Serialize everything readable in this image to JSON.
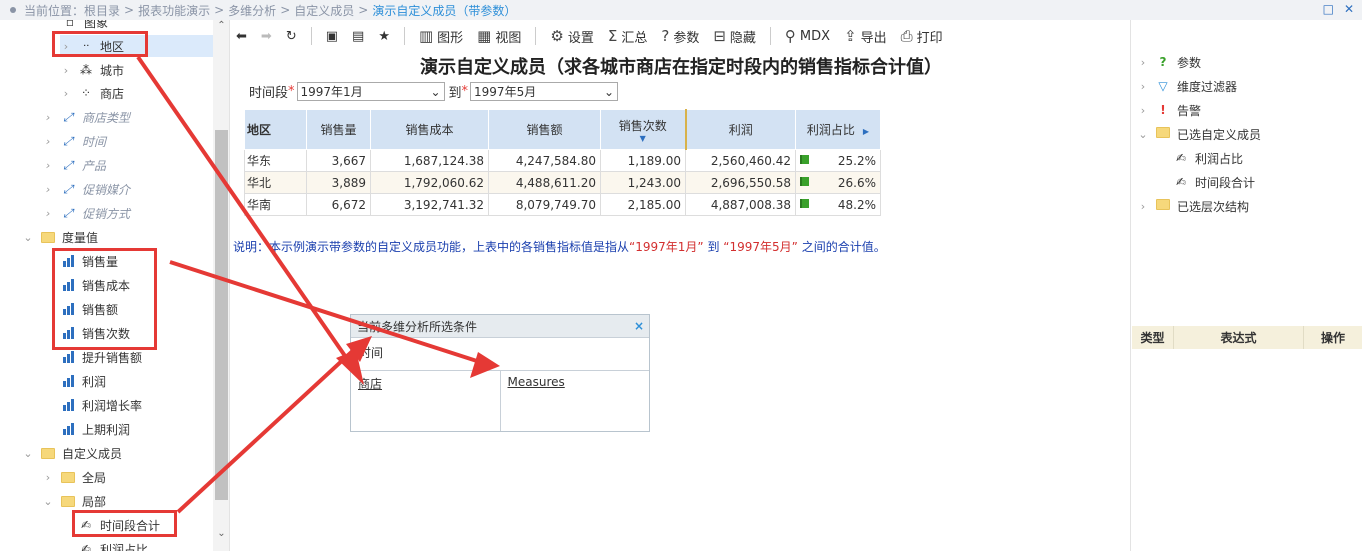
{
  "breadcrumb": {
    "prefix": "当前位置：",
    "items": [
      "根目录",
      "报表功能演示",
      "多维分析",
      "自定义成员"
    ],
    "current": "演示自定义成员（带参数）"
  },
  "left_tree": {
    "partial_top": "图象",
    "region": "地区",
    "city": "城市",
    "store": "商店",
    "dims": [
      "商店类型",
      "时间",
      "产品",
      "促销媒介",
      "促销方式"
    ],
    "measures_folder": "度量值",
    "measures": [
      "销售量",
      "销售成本",
      "销售额",
      "销售次数",
      "提升销售额",
      "利润",
      "利润增长率",
      "上期利润"
    ],
    "custom_folder": "自定义成员",
    "global": "全局",
    "local": "局部",
    "period_total": "时间段合计",
    "profit_ratio": "利润占比"
  },
  "toolbar": {
    "chart": "图形",
    "view": "视图",
    "settings": "设置",
    "summary": "汇总",
    "params": "参数",
    "hide": "隐藏",
    "mdx": "MDX",
    "export": "导出",
    "print": "打印"
  },
  "report": {
    "title": "演示自定义成员（求各城市商店在指定时段内的销售指标合计值）",
    "period_label": "时间段",
    "from": "1997年1月",
    "to_label": "到",
    "to": "1997年5月",
    "columns": [
      "地区",
      "销售量",
      "销售成本",
      "销售额",
      "销售次数",
      "利润",
      "利润占比"
    ],
    "rows": [
      [
        "华东",
        "3,667",
        "1,687,124.38",
        "4,247,584.80",
        "1,189.00",
        "2,560,460.42",
        "25.2%"
      ],
      [
        "华北",
        "3,889",
        "1,792,060.62",
        "4,488,611.20",
        "1,243.00",
        "2,696,550.58",
        "26.6%"
      ],
      [
        "华南",
        "6,672",
        "3,192,741.32",
        "8,079,749.70",
        "2,185.00",
        "4,887,008.38",
        "48.2%"
      ]
    ],
    "note_a": "说明：本示例演示带参数的自定义成员功能，上表中的各销售指标值是指从",
    "note_q1": "“1997年1月”",
    "note_b": " 到 ",
    "note_q2": "“1997年5月”",
    "note_c": " 之间的合计值。"
  },
  "dialog": {
    "title": "当前多维分析所选条件",
    "row": "时间",
    "left": "商店",
    "right": "Measures",
    "close": "×"
  },
  "right_tree": {
    "params": "参数",
    "filter": "维度过滤器",
    "alert": "告警",
    "selected_custom": "已选自定义成员",
    "profit_ratio": "利润占比",
    "period_total": "时间段合计",
    "selected_hier": "已选层次结构"
  },
  "right_table": {
    "type": "类型",
    "expr": "表达式",
    "op": "操作"
  },
  "colors": {
    "accent": "#2d8fd8",
    "header": "#d3e2f3",
    "red": "#e53935",
    "flag": "#3aa12b"
  }
}
